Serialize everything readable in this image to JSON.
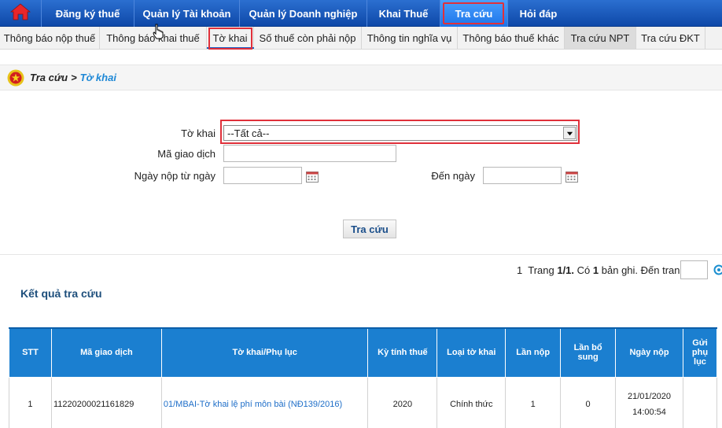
{
  "topnav": {
    "items": [
      {
        "label": "Đăng ký thuế"
      },
      {
        "label": "Quản lý Tài khoản"
      },
      {
        "label": "Quản lý Doanh nghiệp"
      },
      {
        "label": "Khai Thuế"
      },
      {
        "label": "Tra cứu"
      },
      {
        "label": "Hỏi đáp"
      }
    ],
    "active_index": 4,
    "accent": "#1c74e8",
    "highlight_color": "#e0303a"
  },
  "subnav": {
    "items": [
      {
        "label": "Thông báo nộp thuế"
      },
      {
        "label": "Thông báo khai thuế"
      },
      {
        "label": "Tờ khai"
      },
      {
        "label": "Số thuế còn phải nộp"
      },
      {
        "label": "Thông tin nghĩa vụ"
      },
      {
        "label": "Thông báo thuế khác"
      },
      {
        "label": "Tra cứu NPT"
      },
      {
        "label": "Tra cứu ĐKT"
      }
    ],
    "current_index": 2,
    "selected_index": 6
  },
  "breadcrumb": {
    "parent": "Tra cứu",
    "separator": ">",
    "current": "Tờ khai"
  },
  "form": {
    "to_khai_label": "Tờ khai",
    "to_khai_value": "--Tất cả--",
    "ma_giao_dich_label": "Mã giao dịch",
    "ma_giao_dich_value": "",
    "ngay_nop_label": "Ngày nộp từ ngày",
    "ngay_nop_value": "",
    "den_ngay_label": "Đến ngày",
    "den_ngay_value": "",
    "search_button": "Tra cứu"
  },
  "pagination": {
    "current_page": "1",
    "trang_label": "Trang",
    "page_ratio": "1/1.",
    "co_label": "Có",
    "record_count": "1",
    "ban_ghi_label": "bản ghi. Đến trang",
    "goto_value": ""
  },
  "results": {
    "title": "Kết quả tra cứu",
    "columns": [
      "STT",
      "Mã giao dịch",
      "Tờ khai/Phụ lục",
      "Kỳ tính thuế",
      "Loại tờ khai",
      "Lần nộp",
      "Lần bổ sung",
      "Ngày nộp",
      "Gửi phụ lục"
    ],
    "rows": [
      {
        "stt": "1",
        "ma_giao_dich": "11220200021161829",
        "to_khai": "01/MBAI-Tờ khai lệ phí môn bài (NĐ139/2016)",
        "ky_tinh_thue": "2020",
        "loai_to_khai": "Chính thức",
        "lan_nop": "1",
        "lan_bo_sung": "0",
        "ngay_nop_date": "21/01/2020",
        "ngay_nop_time": "14:00:54",
        "gui_phu_luc": ""
      }
    ]
  },
  "icons": {
    "home": "home-icon",
    "emblem": "national-emblem-icon",
    "calendar": "calendar-icon",
    "dropdown": "chevron-down-icon",
    "go": "go-icon",
    "cursor": "hand-cursor-icon"
  }
}
